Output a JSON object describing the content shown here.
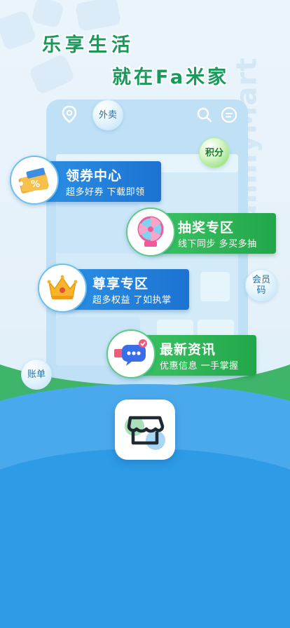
{
  "headline": {
    "line1": "乐享生活",
    "line2": "就在Fa米家"
  },
  "side_brand": "FamilyMart",
  "phone": {
    "bubbles": {
      "takeout": "外卖",
      "points": "积分",
      "member_code_1": "会员",
      "member_code_2": "码",
      "bill": "账单"
    }
  },
  "features": [
    {
      "title": "领券中心",
      "subtitle": "超多好券  下载即领",
      "color": "#1f7fd9",
      "icon": "coupon-ticket-icon"
    },
    {
      "title": "抽奖专区",
      "subtitle": "线下同步  多买多抽",
      "color": "#2bb057",
      "icon": "prize-wheel-icon"
    },
    {
      "title": "尊享专区",
      "subtitle": "超多权益  了如执掌",
      "color": "#1f7fd9",
      "icon": "crown-icon"
    },
    {
      "title": "最新资讯",
      "subtitle": "优惠信息  一手掌握",
      "color": "#2bb057",
      "icon": "chat-bubble-icon"
    }
  ],
  "colors": {
    "brand_green": "#1a9a5a",
    "brand_blue": "#2e9be6",
    "wave_green": "#3fb56a"
  },
  "app_icon": "store-awning-icon"
}
